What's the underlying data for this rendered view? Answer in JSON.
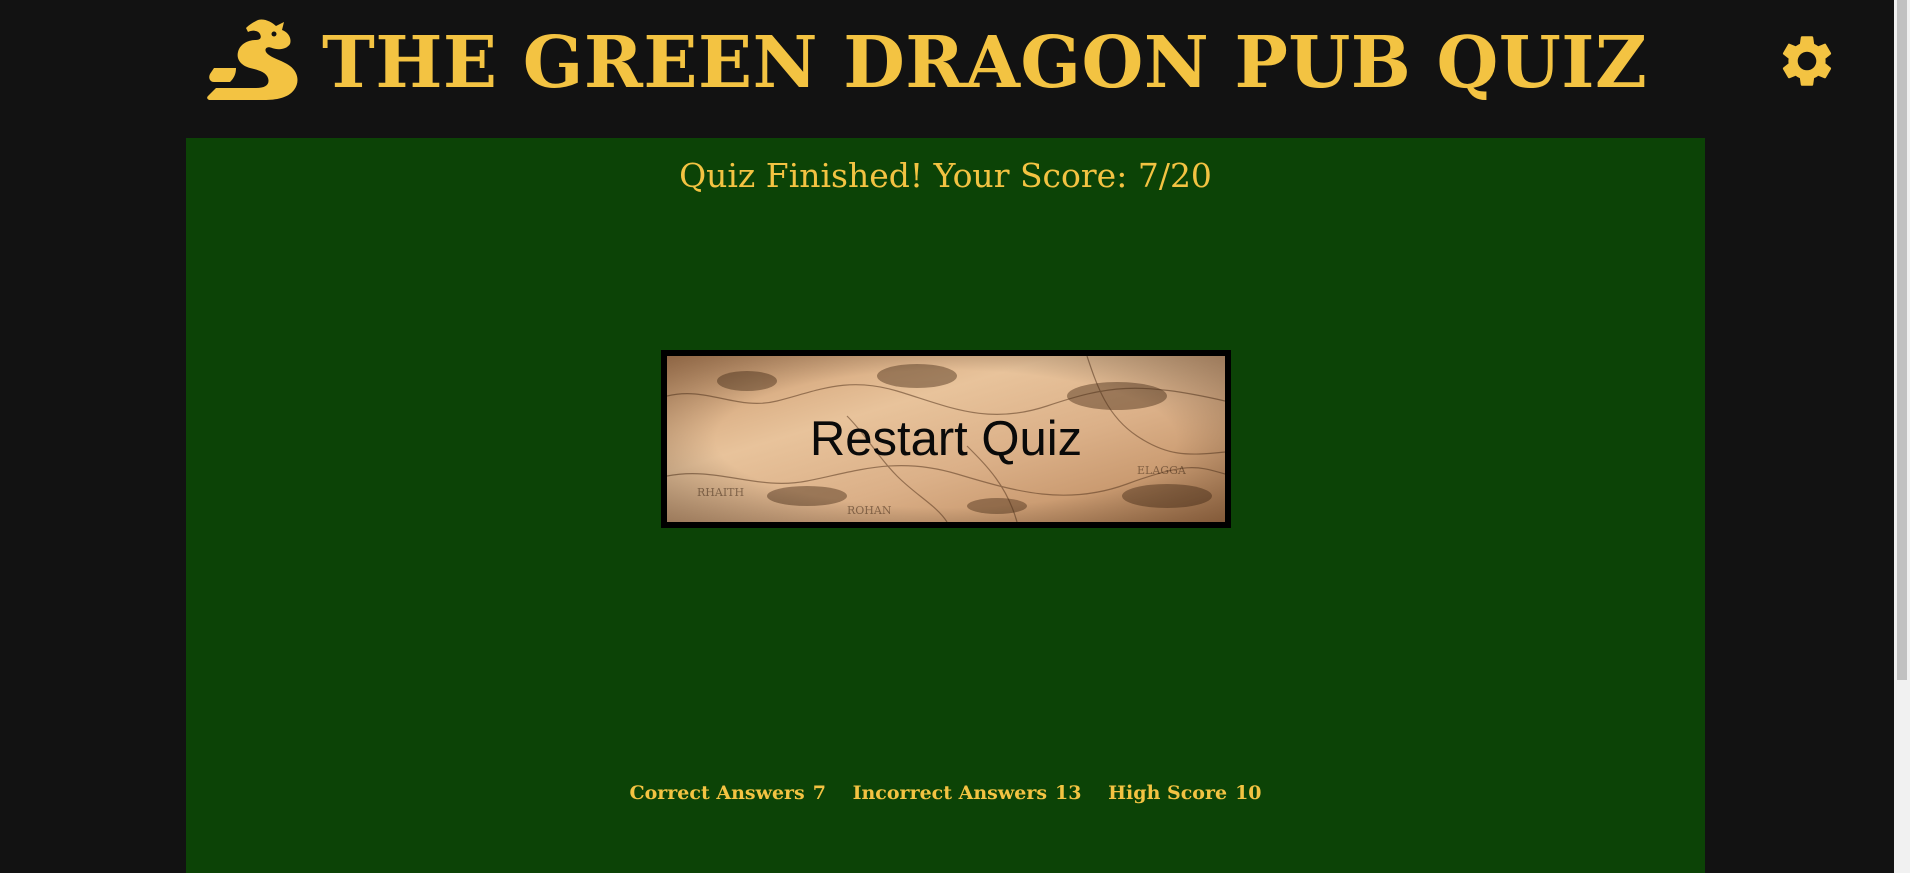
{
  "header": {
    "title": "The Green Dragon Pub Quiz",
    "logo_icon": "dragon-icon",
    "settings_icon": "gear-icon"
  },
  "result": {
    "heading": "Quiz Finished! Your Score: 7/20"
  },
  "restart_button": {
    "label": "Restart Quiz",
    "background": "map-image"
  },
  "stats": {
    "correct_label": "Correct Answers",
    "correct_value": "7",
    "incorrect_label": "Incorrect Answers",
    "incorrect_value": "13",
    "high_score_label": "High Score",
    "high_score_value": "10"
  },
  "colors": {
    "page_background": "#121212",
    "panel_background": "#0c4306",
    "accent_gold": "#f3c342",
    "button_border": "#000000"
  }
}
